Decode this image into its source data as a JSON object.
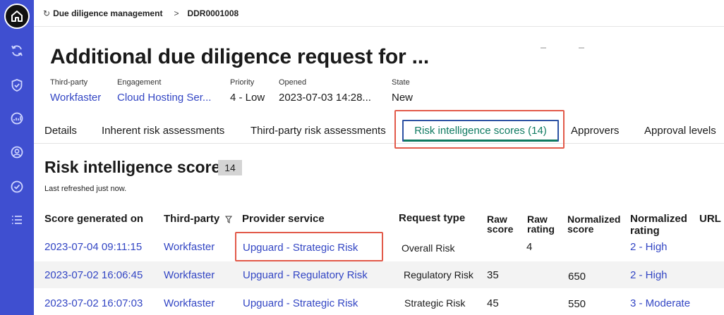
{
  "breadcrumb": {
    "parent": "Due diligence management",
    "separator": ">",
    "current": "DDR0001008"
  },
  "record": {
    "title": "Additional due diligence request for ...",
    "fields": [
      {
        "label": "Third-party",
        "value": "Workfaster",
        "link": true
      },
      {
        "label": "Engagement",
        "value": "Cloud Hosting Ser...",
        "link": true
      },
      {
        "label": "Priority",
        "value": "4 - Low",
        "link": false
      },
      {
        "label": "Opened",
        "value": "2023-07-03 14:28...",
        "link": false
      },
      {
        "label": "State",
        "value": "New",
        "link": false
      }
    ]
  },
  "tabs": [
    {
      "label": "Details",
      "active": false
    },
    {
      "label": "Inherent risk assessments",
      "active": false
    },
    {
      "label": "Third-party risk assessments",
      "active": false
    },
    {
      "label": "Risk intelligence scores (14)",
      "active": true
    },
    {
      "label": "Approvers",
      "active": false
    },
    {
      "label": "Approval levels",
      "active": false
    }
  ],
  "section": {
    "title": "Risk intelligence scores",
    "count": "14",
    "refreshed": "Last refreshed just now."
  },
  "table": {
    "headers": {
      "score_generated_on": "Score generated on",
      "third_party": "Third-party",
      "provider_service": "Provider service",
      "request_type": "Request type",
      "raw_score_1": "Raw",
      "raw_score_2": "score",
      "raw_rating_1": "Raw",
      "raw_rating_2": "rating",
      "normalized_score_1": "Normalized",
      "normalized_score_2": "score",
      "normalized_rating_1": "Normalized",
      "normalized_rating_2": "rating",
      "url": "URL"
    },
    "rows": [
      {
        "generated": "2023-07-04 09:11:15",
        "third_party": "Workfaster",
        "provider": "Upguard - Strategic Risk",
        "request_type": "Overall Risk",
        "raw_score": "",
        "raw_rating": "4",
        "normalized_score": "",
        "normalized_rating": "2 - High"
      },
      {
        "generated": "2023-07-02 16:06:45",
        "third_party": "Workfaster",
        "provider": "Upguard - Regulatory Risk",
        "request_type": "Regulatory Risk",
        "raw_score": "35",
        "raw_rating": "",
        "normalized_score": "650",
        "normalized_rating": "2 - High"
      },
      {
        "generated": "2023-07-02 16:07:03",
        "third_party": "Workfaster",
        "provider": "Upguard - Strategic Risk",
        "request_type": "Strategic Risk",
        "raw_score": "45",
        "raw_rating": "",
        "normalized_score": "550",
        "normalized_rating": "3 - Moderate"
      }
    ]
  },
  "colors": {
    "rail": "#3f4fd0",
    "link": "#3346c4",
    "active_tab": "#0f7a61",
    "highlight": "#e25a4a"
  }
}
